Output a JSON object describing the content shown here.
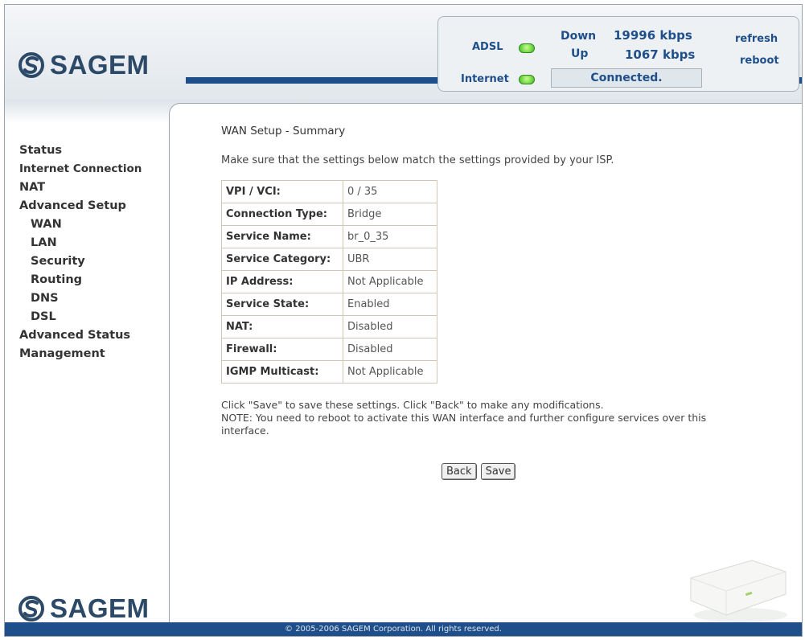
{
  "brand": {
    "name": "SAGEM"
  },
  "status": {
    "adsl_label": "ADSL",
    "internet_label": "Internet",
    "down_label": "Down",
    "up_label": "Up",
    "down_value": "19996 kbps",
    "up_value": "1067 kbps",
    "connection_status": "Connected.",
    "refresh_label": "refresh",
    "reboot_label": "reboot",
    "led_color": "#3dbb1f"
  },
  "sidebar": {
    "items": [
      {
        "label": "Status"
      },
      {
        "label": "Internet Connection"
      },
      {
        "label": "NAT"
      },
      {
        "label": "Advanced Setup"
      },
      {
        "label": "WAN"
      },
      {
        "label": "LAN"
      },
      {
        "label": "Security"
      },
      {
        "label": "Routing"
      },
      {
        "label": "DNS"
      },
      {
        "label": "DSL"
      },
      {
        "label": "Advanced Status"
      },
      {
        "label": "Management"
      }
    ]
  },
  "main": {
    "title": "WAN Setup - Summary",
    "intro": "Make sure that the settings below match the settings provided by your ISP.",
    "rows": [
      {
        "key": "VPI / VCI:",
        "value": "0 / 35"
      },
      {
        "key": "Connection Type:",
        "value": "Bridge"
      },
      {
        "key": "Service Name:",
        "value": "br_0_35"
      },
      {
        "key": "Service Category:",
        "value": "UBR"
      },
      {
        "key": "IP Address:",
        "value": "Not Applicable"
      },
      {
        "key": "Service State:",
        "value": "Enabled"
      },
      {
        "key": "NAT:",
        "value": "Disabled"
      },
      {
        "key": "Firewall:",
        "value": "Disabled"
      },
      {
        "key": "IGMP Multicast:",
        "value": "Not Applicable"
      }
    ],
    "note_line1": "Click \"Save\" to save these settings. Click \"Back\" to make any modifications.",
    "note_line2": "NOTE: You need to reboot to activate this WAN interface and further configure services over this interface.",
    "back_label": "Back",
    "save_label": "Save"
  },
  "footer": {
    "copyright": "© 2005-2006 SAGEM Corporation. All rights reserved."
  },
  "colors": {
    "brand_blue": "#1f4f8a",
    "logo_text": "#2c4a67"
  }
}
